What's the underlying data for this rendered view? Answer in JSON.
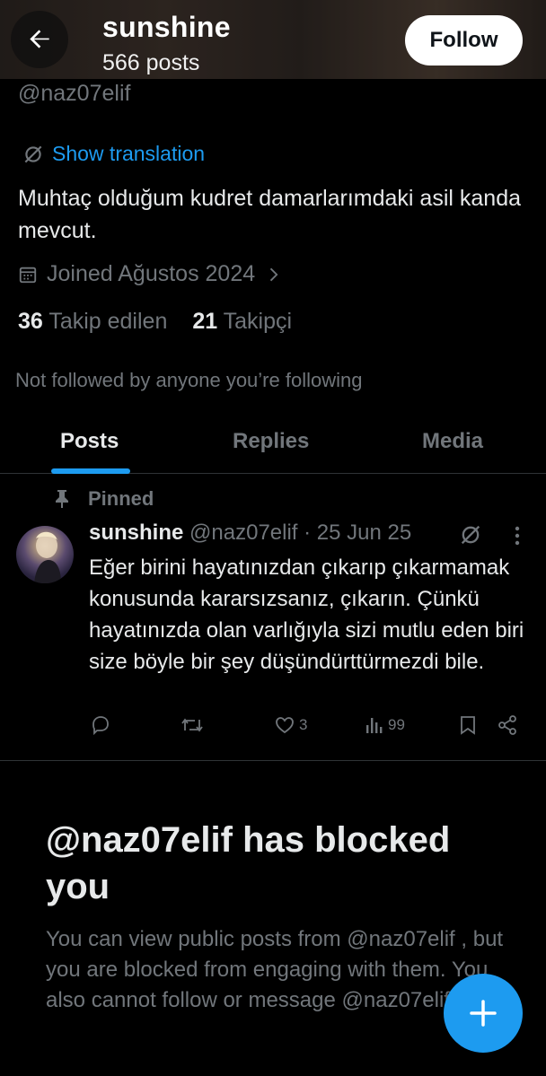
{
  "header": {
    "display_name": "sunshine",
    "post_count": "566 posts",
    "follow_label": "Follow"
  },
  "profile": {
    "handle": "@naz07elif",
    "translate_label": "Show translation",
    "bio": "Muhtaç olduğum kudret damarlarımdaki asil kanda mevcut.",
    "joined": "Joined Ağustos 2024",
    "following_count": "36",
    "following_label": "Takip edilen",
    "followers_count": "21",
    "followers_label": "Takipçi",
    "not_followed": "Not followed by anyone you’re following"
  },
  "tabs": [
    {
      "label": "Posts",
      "active": true
    },
    {
      "label": "Replies",
      "active": false
    },
    {
      "label": "Media",
      "active": false
    }
  ],
  "pinned_post": {
    "pinned_label": "Pinned",
    "author_name": "sunshine",
    "author_meta": "@naz07elif · 25 Jun 25",
    "text": "Eğer birini hayatınızdan çıkarıp çıkarmamak konusunda kararsızsanız, çıkarın. Çünkü hayatınızda olan varlığıyla sizi mutlu eden biri size böyle bir şey düşündürttürmezdi bile.",
    "likes": "3",
    "views": "99"
  },
  "blocked": {
    "title": "@naz07elif has blocked you",
    "description": "You can view public posts from @naz07elif , but you are blocked from engaging with them. You also cannot follow or message @naz07elif."
  },
  "icons": {
    "back": "arrow-left-icon",
    "translate": "grok-translate-icon",
    "calendar": "calendar-icon",
    "chevron": "chevron-right-icon",
    "pin": "pin-icon",
    "more": "more-vertical-icon",
    "reply": "reply-icon",
    "repost": "repost-icon",
    "like": "heart-icon",
    "views": "views-icon",
    "bookmark": "bookmark-icon",
    "share": "share-icon",
    "compose": "plus-icon"
  },
  "colors": {
    "accent": "#1d9bf0",
    "background": "#000000",
    "text": "#e7e9ea",
    "muted": "#71767b"
  }
}
